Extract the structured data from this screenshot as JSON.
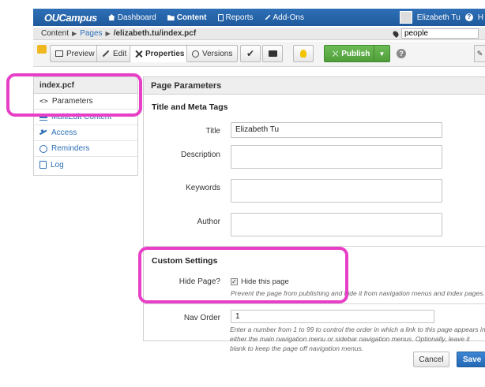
{
  "topnav": {
    "logo": "OUCampus",
    "items": [
      {
        "label": "Dashboard",
        "icon": "home-icon"
      },
      {
        "label": "Content",
        "icon": "folder-icon"
      },
      {
        "label": "Reports",
        "icon": "reports-icon"
      },
      {
        "label": "Add-Ons",
        "icon": "plug-icon"
      }
    ],
    "user": "Elizabeth Tu",
    "help": "H"
  },
  "breadcrumb": {
    "root": "Content",
    "pages": "Pages",
    "path": "/elizabeth.tu/index.pcf",
    "search_value": "people"
  },
  "toolbar": {
    "preview": "Preview",
    "edit": "Edit",
    "properties": "Properties",
    "versions": "Versions",
    "publish": "Publish"
  },
  "sidebar": {
    "file": "index.pcf",
    "items": [
      {
        "code": "<>",
        "label": "Parameters"
      },
      {
        "label": "MultiEdit Content"
      },
      {
        "label": "Access"
      },
      {
        "label": "Reminders"
      },
      {
        "label": "Log"
      }
    ]
  },
  "main": {
    "heading": "Page Parameters",
    "meta_section": "Title and Meta Tags",
    "title_label": "Title",
    "title_value": "Elizabeth Tu",
    "description_label": "Description",
    "keywords_label": "Keywords",
    "author_label": "Author",
    "custom_section": "Custom Settings",
    "hide_label": "Hide Page?",
    "hide_checkbox": "Hide this page",
    "hide_hint": "Prevent the page from publishing and hide it from navigation menus and index pages.",
    "nav_label": "Nav Order",
    "nav_value": "1",
    "nav_hint": "Enter a number from 1 to 99 to control the order in which a link to this page appears in either the main navigation menu or sidebar navigation menus. Optionally, leave it blank to keep the page off navigation menus."
  },
  "actions": {
    "cancel": "Cancel",
    "save": "Save"
  },
  "colors": {
    "nav_blue": "#1f5a9c",
    "publish_green": "#4e9e3a",
    "highlight": "#e83fc7"
  }
}
